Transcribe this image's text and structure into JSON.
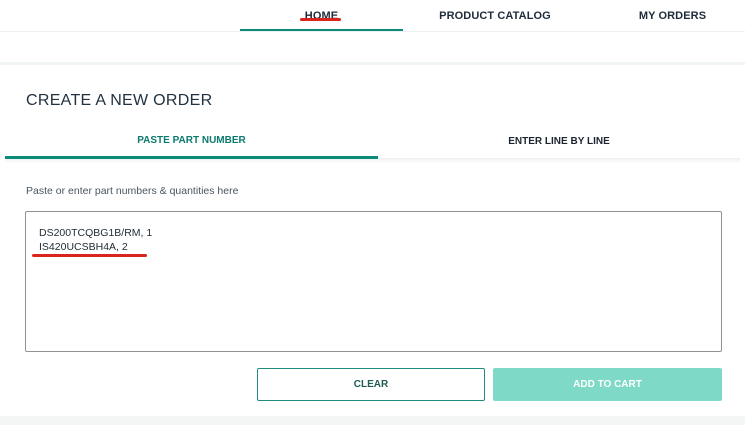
{
  "nav": {
    "items": [
      {
        "label": "HOME",
        "active": true
      },
      {
        "label": "PRODUCT CATALOG",
        "active": false
      },
      {
        "label": "MY ORDERS",
        "active": false
      }
    ]
  },
  "page": {
    "title": "CREATE A NEW ORDER"
  },
  "tabs": [
    {
      "label": "PASTE PART NUMBER",
      "active": true
    },
    {
      "label": "ENTER LINE BY LINE",
      "active": false
    }
  ],
  "form": {
    "instructions": "Paste or enter part numbers & quantities here",
    "lines": [
      "DS200TCQBG1B/RM, 1",
      "IS420UCSBH4A, 2"
    ]
  },
  "buttons": {
    "clear": "CLEAR",
    "add_to_cart": "ADD TO CART"
  },
  "colors": {
    "accent": "#0c8a7a",
    "add_button_disabled": "#7fd9c7",
    "annotation_red": "#d9251d"
  }
}
